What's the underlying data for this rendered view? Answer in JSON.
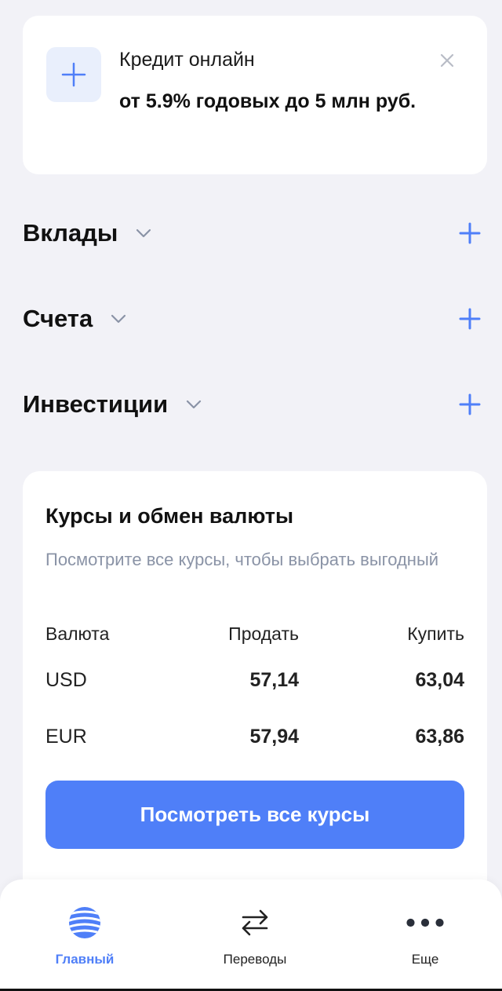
{
  "promo": {
    "title": "Кредит онлайн",
    "subtitle": "от 5.9% годовых до 5 млн руб.",
    "icon": "plus-icon",
    "close_icon": "close-icon"
  },
  "sections": [
    {
      "label": "Вклады"
    },
    {
      "label": "Счета"
    },
    {
      "label": "Инвестиции"
    }
  ],
  "rates": {
    "title": "Курсы и обмен валюты",
    "description": "Посмотрите все курсы, чтобы выбрать выгодный",
    "columns": [
      "Валюта",
      "Продать",
      "Купить"
    ],
    "rows": [
      {
        "currency": "USD",
        "sell": "57,14",
        "buy": "63,04"
      },
      {
        "currency": "EUR",
        "sell": "57,94",
        "buy": "63,86"
      }
    ],
    "button_label": "Посмотреть все курсы"
  },
  "nav": {
    "items": [
      {
        "label": "Главный",
        "icon": "globe-icon",
        "active": true
      },
      {
        "label": "Переводы",
        "icon": "transfer-arrows-icon",
        "active": false
      },
      {
        "label": "Еще",
        "icon": "more-dots-icon",
        "active": false
      }
    ]
  },
  "colors": {
    "accent": "#4f7ff8",
    "background": "#f2f2f7",
    "card": "#ffffff",
    "muted_text": "#8a93a6"
  }
}
